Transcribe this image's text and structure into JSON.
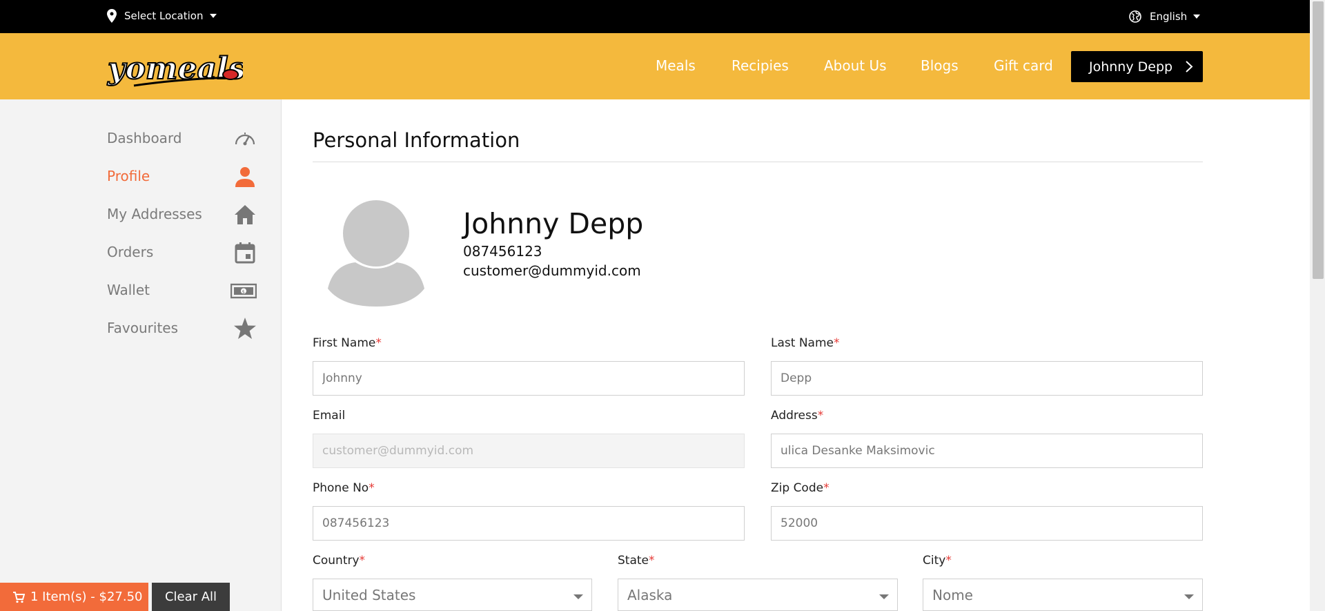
{
  "topbar": {
    "location_label": "Select Location",
    "language": "English"
  },
  "header": {
    "logo_text": "yomeals",
    "nav": [
      "Meals",
      "Recipies",
      "About Us",
      "Blogs",
      "Gift card"
    ],
    "user_button": "Johnny Depp"
  },
  "sidebar": {
    "items": [
      {
        "label": "Dashboard",
        "icon": "speedometer-icon",
        "active": false
      },
      {
        "label": "Profile",
        "icon": "person-icon",
        "active": true
      },
      {
        "label": "My Addresses",
        "icon": "home-icon",
        "active": false
      },
      {
        "label": "Orders",
        "icon": "calendar-icon",
        "active": false
      },
      {
        "label": "Wallet",
        "icon": "money-icon",
        "active": false
      },
      {
        "label": "Favourites",
        "icon": "star-icon",
        "active": false
      }
    ]
  },
  "main": {
    "title": "Personal Information",
    "profile": {
      "name": "Johnny Depp",
      "phone": "087456123",
      "email": "customer@dummyid.com"
    },
    "fields": {
      "first_name": {
        "label": "First Name",
        "value": "Johnny"
      },
      "last_name": {
        "label": "Last Name",
        "value": "Depp"
      },
      "email": {
        "label": "Email",
        "value": "customer@dummyid.com"
      },
      "address": {
        "label": "Address",
        "value": "ulica Desanke Maksimovic"
      },
      "phone": {
        "label": "Phone No",
        "value": "087456123"
      },
      "zip": {
        "label": "Zip Code",
        "value": "52000"
      },
      "country": {
        "label": "Country",
        "value": "United States"
      },
      "state": {
        "label": "State",
        "value": "Alaska"
      },
      "city": {
        "label": "City",
        "value": "Nome"
      }
    },
    "required_mark": "*"
  },
  "cart": {
    "summary": "1 Item(s) - $27.50",
    "clear_label": "Clear All"
  },
  "colors": {
    "brand_yellow": "#f4b93d",
    "accent_orange": "#f26b3a",
    "topbar_black": "#000000"
  }
}
